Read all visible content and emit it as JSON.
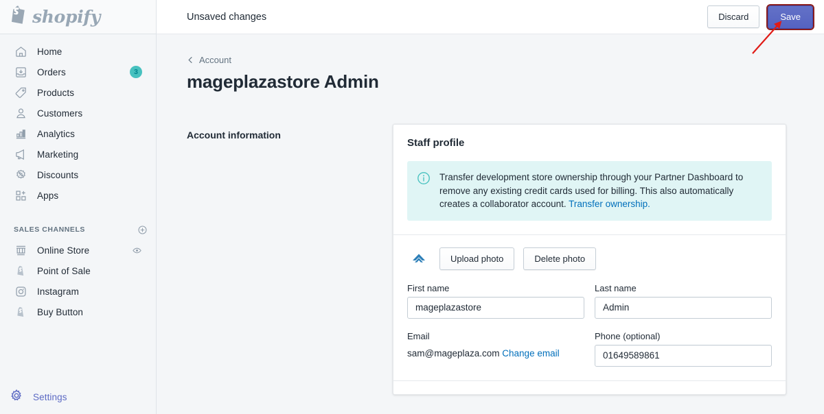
{
  "brand": {
    "name": "shopify",
    "logo_icon": "shopify-bag-logo"
  },
  "sidebar": {
    "items": [
      {
        "label": "Home",
        "icon": "home-icon"
      },
      {
        "label": "Orders",
        "icon": "orders-inbox-icon",
        "badge": "3"
      },
      {
        "label": "Products",
        "icon": "tag-icon"
      },
      {
        "label": "Customers",
        "icon": "person-icon"
      },
      {
        "label": "Analytics",
        "icon": "bar-chart-icon"
      },
      {
        "label": "Marketing",
        "icon": "megaphone-icon"
      },
      {
        "label": "Discounts",
        "icon": "discount-percent-icon"
      },
      {
        "label": "Apps",
        "icon": "apps-grid-plus-icon"
      }
    ],
    "sales_channels": {
      "title": "SALES CHANNELS",
      "add_icon": "plus-circle-icon",
      "items": [
        {
          "label": "Online Store",
          "icon": "storefront-icon",
          "trailing_icon": "eye-icon"
        },
        {
          "label": "Point of Sale",
          "icon": "pos-bag-icon"
        },
        {
          "label": "Instagram",
          "icon": "instagram-icon"
        },
        {
          "label": "Buy Button",
          "icon": "buy-button-bag-icon"
        }
      ]
    },
    "settings": {
      "label": "Settings",
      "icon": "gear-icon"
    },
    "accent_color": "#5c6ac4",
    "badge_color": "#47c1bf"
  },
  "topbar": {
    "message": "Unsaved changes",
    "discard_label": "Discard",
    "save_label": "Save",
    "save_highlight_color": "#8a1c1c",
    "primary_color": "#5563c1"
  },
  "page": {
    "breadcrumb": "Account",
    "breadcrumb_icon": "chevron-left-icon",
    "title": "mageplazastore Admin",
    "section_label": "Account information"
  },
  "card": {
    "title": "Staff profile",
    "banner": {
      "icon": "info-circle-icon",
      "text": "Transfer development store ownership through your Partner Dashboard to remove any existing credit cards used for billing. This also automatically creates a collaborator account. ",
      "link_text": "Transfer ownership.",
      "background": "#e0f5f5"
    },
    "photo": {
      "avatar_icon": "chevron-up-avatar-icon",
      "upload_label": "Upload photo",
      "delete_label": "Delete photo"
    },
    "fields": {
      "first_name": {
        "label": "First name",
        "value": "mageplazastore"
      },
      "last_name": {
        "label": "Last name",
        "value": "Admin"
      },
      "email": {
        "label": "Email",
        "value": "sam@mageplaza.com",
        "link_text": "Change email"
      },
      "phone": {
        "label": "Phone (optional)",
        "value": "01649589861"
      }
    }
  },
  "annotation": {
    "type": "red-arrow",
    "points_to": "save-button",
    "color": "#e01b16"
  }
}
